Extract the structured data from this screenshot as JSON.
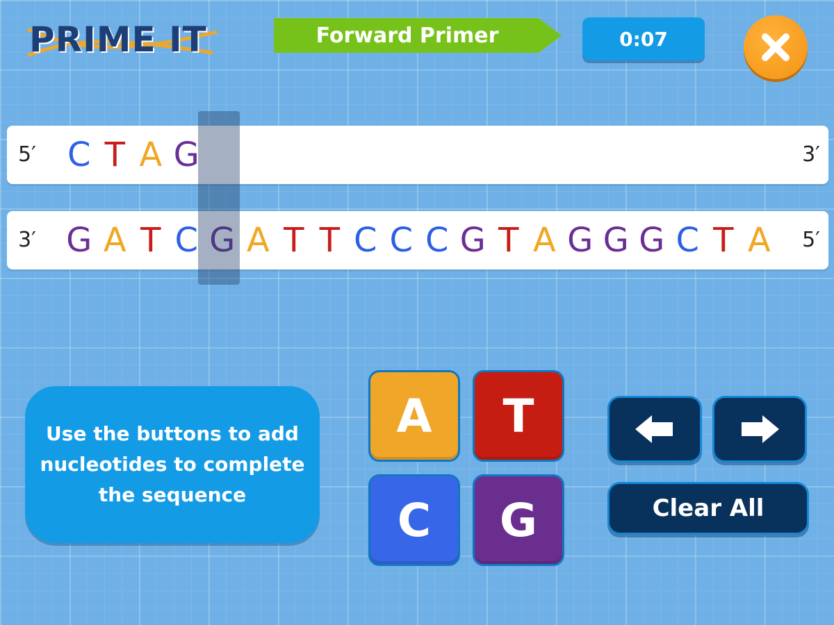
{
  "app": {
    "logo_text": "PRIME IT"
  },
  "header": {
    "mode_label": "Forward Primer",
    "timer": "0:07"
  },
  "strands": {
    "primer": {
      "left_end": "5′",
      "right_end": "3′",
      "bases": [
        "C",
        "T",
        "A",
        "G"
      ]
    },
    "template": {
      "left_end": "3′",
      "right_end": "5′",
      "bases": [
        "G",
        "A",
        "T",
        "C",
        "G",
        "A",
        "T",
        "T",
        "C",
        "C",
        "C",
        "G",
        "T",
        "A",
        "G",
        "G",
        "G",
        "C",
        "T",
        "A"
      ]
    }
  },
  "instructions": "Use the buttons to add nucleotides to complete the sequence",
  "nucleotide_buttons": {
    "a": "A",
    "t": "T",
    "c": "C",
    "g": "G"
  },
  "controls": {
    "clear_label": "Clear All"
  },
  "colors": {
    "A": "#f0a722",
    "T": "#c81d1a",
    "C": "#2d5fe6",
    "G": "#6a2e94",
    "banner": "#76c21a",
    "timer": "#149be6",
    "close": "#f39414"
  }
}
